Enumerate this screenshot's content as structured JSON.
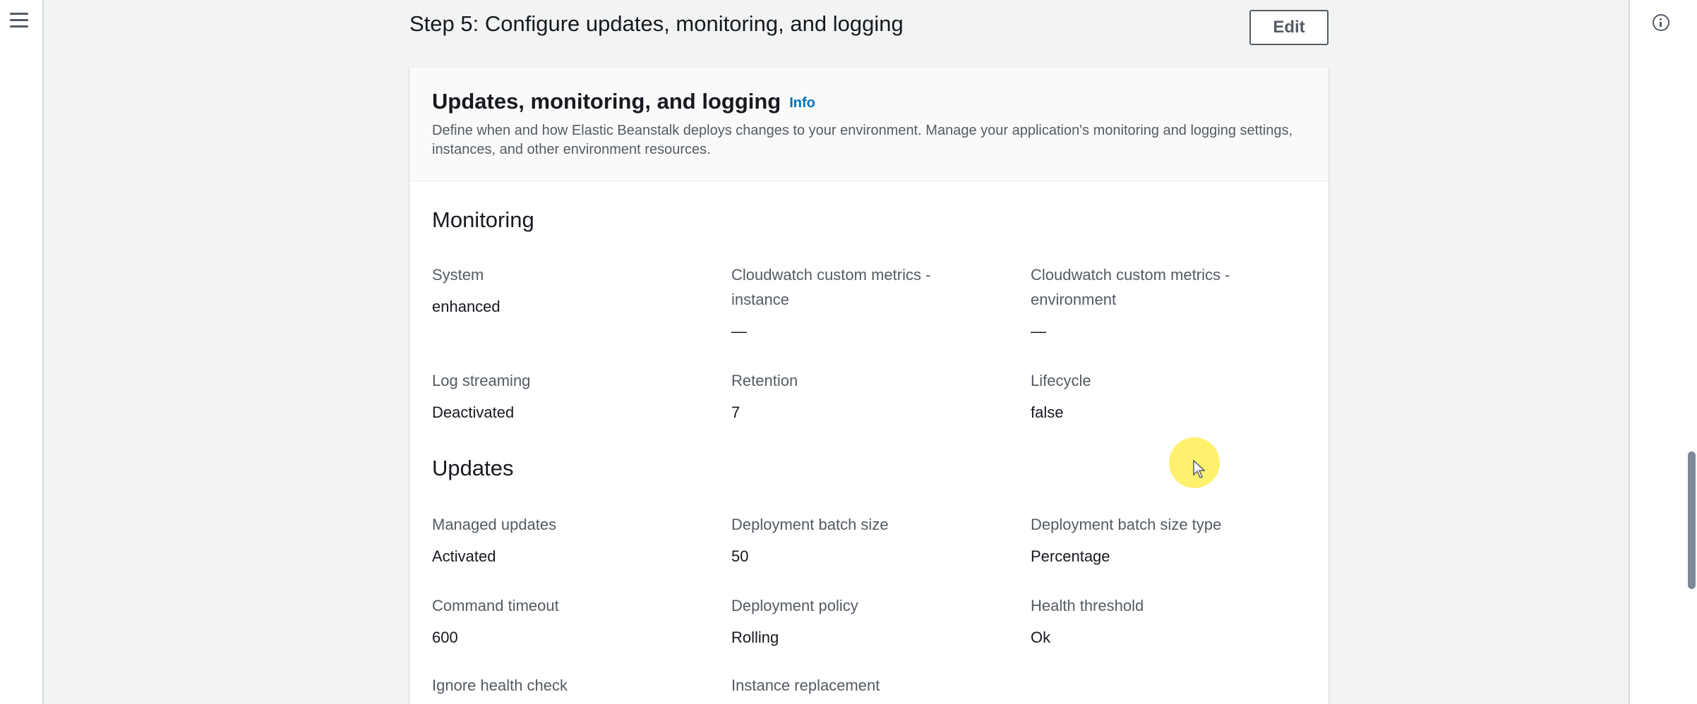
{
  "step": {
    "title": "Step 5: Configure updates, monitoring, and logging",
    "edit_label": "Edit"
  },
  "card": {
    "title": "Updates, monitoring, and logging",
    "info_label": "Info",
    "description": "Define when and how Elastic Beanstalk deploys changes to your environment. Manage your application's monitoring and logging settings, instances, and other environment resources."
  },
  "monitoring": {
    "title": "Monitoring",
    "fields": [
      {
        "label": "System",
        "value": "enhanced"
      },
      {
        "label": "Cloudwatch custom metrics - instance",
        "value": "—"
      },
      {
        "label": "Cloudwatch custom metrics - environment",
        "value": "—"
      },
      {
        "label": "Log streaming",
        "value": "Deactivated"
      },
      {
        "label": "Retention",
        "value": "7"
      },
      {
        "label": "Lifecycle",
        "value": "false"
      }
    ]
  },
  "updates": {
    "title": "Updates",
    "fields": [
      {
        "label": "Managed updates",
        "value": "Activated"
      },
      {
        "label": "Deployment batch size",
        "value": "50"
      },
      {
        "label": "Deployment batch size type",
        "value": "Percentage"
      },
      {
        "label": "Command timeout",
        "value": "600"
      },
      {
        "label": "Deployment policy",
        "value": "Rolling"
      },
      {
        "label": "Health threshold",
        "value": "Ok"
      },
      {
        "label": "Ignore health check",
        "value": ""
      },
      {
        "label": "Instance replacement",
        "value": ""
      }
    ]
  },
  "icons": {
    "menu": "hamburger-menu-icon",
    "info": "info-circle-icon"
  },
  "colors": {
    "link": "#0073bb",
    "text": "#16191f",
    "secondary_text": "#545b64",
    "cursor_highlight": "#ffec3c"
  }
}
